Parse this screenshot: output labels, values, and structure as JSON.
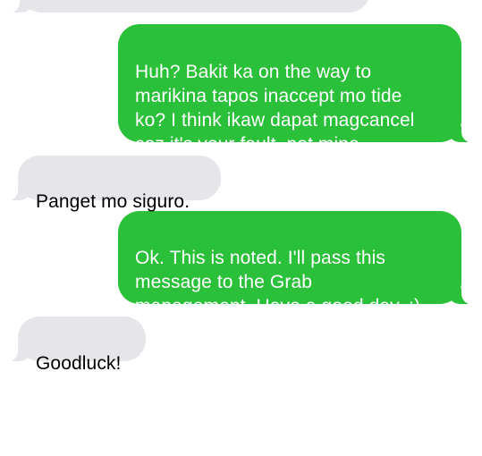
{
  "conversation": {
    "messages": [
      {
        "sender": "other",
        "text": ""
      },
      {
        "sender": "me",
        "text": "Huh? Bakit ka on the way to\nmarikina tapos inaccept mo tide\nko? I think ikaw dapat magcancel\ncoz it's your fault, not mine"
      },
      {
        "sender": "other",
        "text": "Panget mo siguro."
      },
      {
        "sender": "me",
        "text": "Ok. This is noted. I'll pass this\nmessage to the Grab\nmanagement. Have a good day. :)"
      },
      {
        "sender": "other",
        "text": "Goodluck!"
      }
    ]
  },
  "colors": {
    "incoming_bubble": "#e5e5ea",
    "outgoing_bubble": "#2bc03a",
    "incoming_text": "#000000",
    "outgoing_text": "#ffffff",
    "background": "#ffffff"
  }
}
